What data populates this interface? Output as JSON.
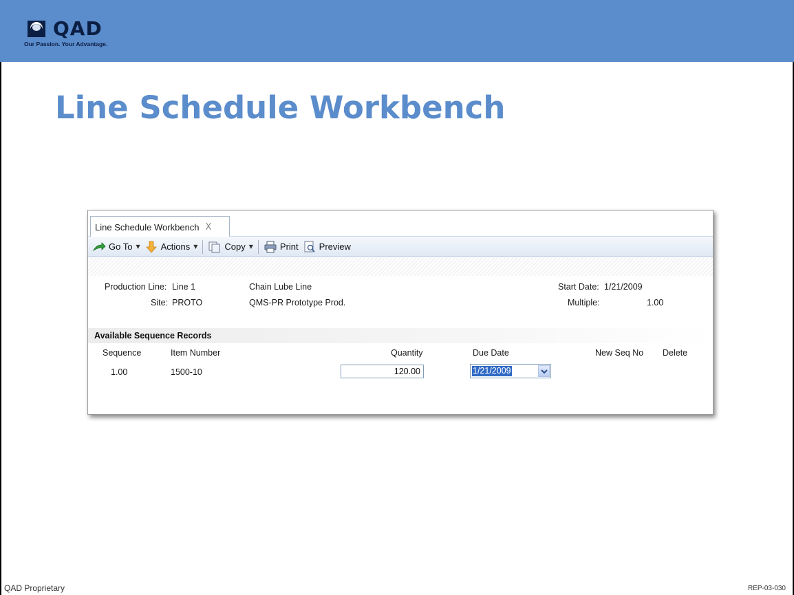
{
  "logo": {
    "word": "QAD",
    "tagline": "Our Passion. Your Advantage."
  },
  "slide": {
    "title": "Line Schedule Workbench"
  },
  "window": {
    "tab": {
      "label": "Line Schedule Workbench",
      "close_glyph": "X"
    },
    "toolbar": {
      "goto_label": "Go To",
      "actions_label": "Actions",
      "copy_label": "Copy",
      "print_label": "Print",
      "preview_label": "Preview"
    },
    "header": {
      "production_line_label": "Production Line:",
      "production_line_value": "Line 1",
      "production_line_desc": "Chain Lube Line",
      "site_label": "Site:",
      "site_value": "PROTO",
      "site_desc": "QMS-PR Prototype Prod.",
      "start_date_label": "Start Date:",
      "start_date_value": "1/21/2009",
      "multiple_label": "Multiple:",
      "multiple_value": "1.00"
    },
    "section": {
      "title": "Available Sequence Records"
    },
    "table": {
      "columns": {
        "sequence": "Sequence",
        "item_number": "Item Number",
        "quantity": "Quantity",
        "due_date": "Due Date",
        "new_seq_no": "New Seq No",
        "delete": "Delete"
      },
      "rows": [
        {
          "sequence": "1.00",
          "item_number": "1500-10",
          "quantity": "120.00",
          "due_date": "1/21/2009"
        }
      ]
    }
  },
  "footer": {
    "left": "QAD Proprietary",
    "right": "REP-03-030"
  }
}
